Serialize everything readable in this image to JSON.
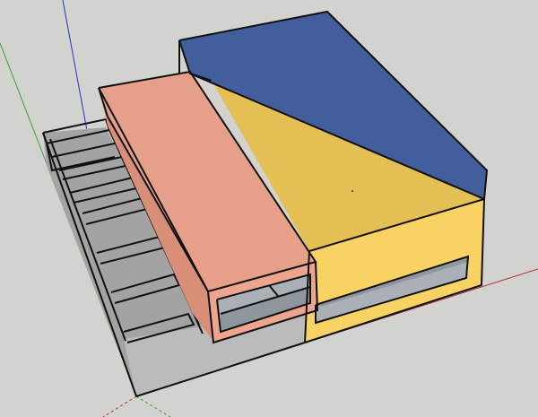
{
  "viewport": {
    "background": "#d2d2cf"
  },
  "colors": {
    "blue_face": "#435e9c",
    "yellow_face": "#e4bf54",
    "yellow_front": "#f8d262",
    "salmon_face": "#e6a08a",
    "salmon_front": "#eda58e",
    "grey_side": "#a3a3a3",
    "grey_front": "#bbbbbb",
    "opening_inner": "#aab0b6",
    "axis_red": "#b03030",
    "axis_green": "#3aa03a",
    "axis_blue": "#2a2ad0",
    "edge": "#111111"
  },
  "scene": {
    "model": "3d-building-massing",
    "icons": [
      "axis-red-icon",
      "axis-green-icon",
      "axis-blue-icon"
    ]
  }
}
